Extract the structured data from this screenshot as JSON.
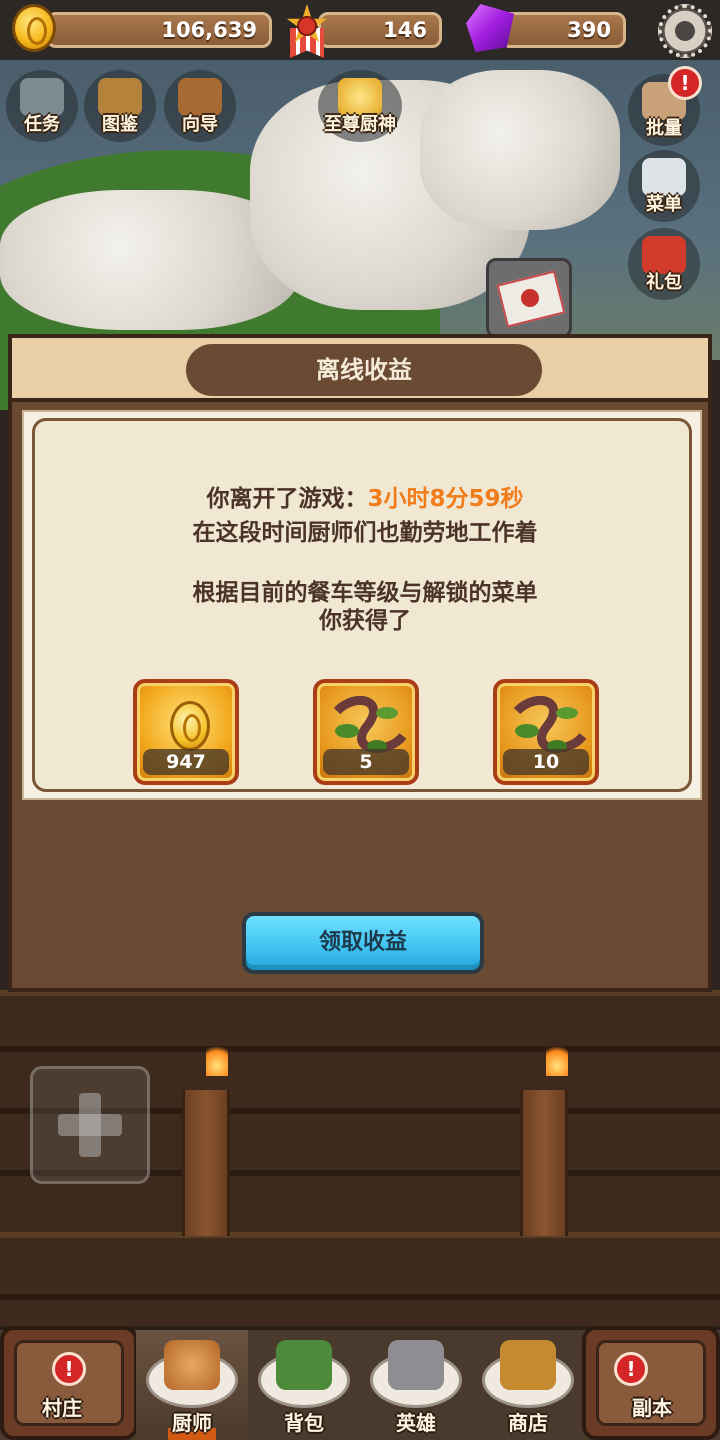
{
  "currencies": {
    "gold": "106,639",
    "medals": "146",
    "gems": "390"
  },
  "top_icons": {
    "quest": "任务",
    "collection": "图鉴",
    "guide": "向导",
    "supreme_chef": "至尊厨神",
    "batch": "批量",
    "menu": "菜单",
    "gift": "礼包"
  },
  "alert_mark": "!",
  "modal": {
    "title": "离线收益",
    "away_prefix": "你离开了游戏：",
    "away_time": "3小时8分59秒",
    "line2": "在这段时间厨师们也勤劳地工作着",
    "line3": "根据目前的餐车等级与解锁的菜单",
    "line4": "你获得了",
    "rewards": [
      {
        "icon": "gold-coin-icon",
        "qty": "947"
      },
      {
        "icon": "vine-ingredient-icon",
        "qty": "5"
      },
      {
        "icon": "vine-ingredient-icon",
        "qty": "10"
      }
    ],
    "claim_button": "领取收益"
  },
  "bottom_nav": {
    "village": "村庄",
    "chef": "厨师",
    "bag": "背包",
    "hero": "英雄",
    "shop": "商店",
    "dungeon": "副本",
    "active_tab": "厨师"
  },
  "colors": {
    "highlight": "#f07c1a",
    "claim_button": "#3ec2f2",
    "modal_brown": "#6b4a33"
  }
}
